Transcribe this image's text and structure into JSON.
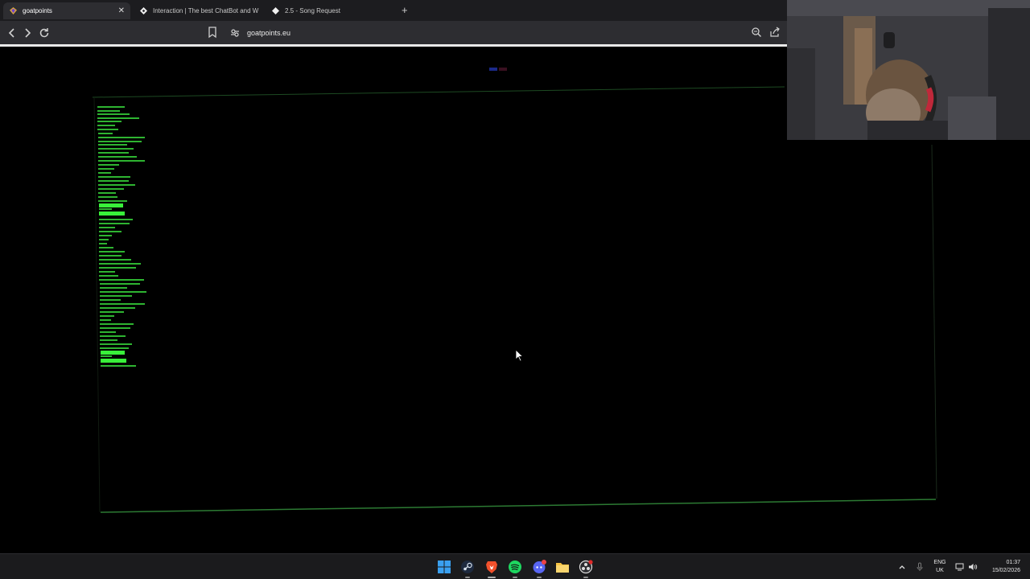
{
  "browser": {
    "tabs": [
      {
        "title": "goatpoints",
        "active": true
      },
      {
        "title": "Interaction | The best ChatBot and W",
        "active": false
      },
      {
        "title": "2.5 - Song Request",
        "active": false
      }
    ],
    "new_tab_icon": "plus-icon",
    "url": "goatpoints.eu"
  },
  "page": {
    "background": "#000000",
    "terminal_color": "#39f03a"
  },
  "taskbar": {
    "apps": [
      "windows-start-icon",
      "steam-icon",
      "brave-browser-icon",
      "spotify-icon",
      "discord-icon",
      "file-explorer-icon",
      "obs-icon"
    ],
    "language": {
      "line1": "ENG",
      "line2": "UK"
    },
    "time": "01:37",
    "date": "15/02/2026"
  }
}
